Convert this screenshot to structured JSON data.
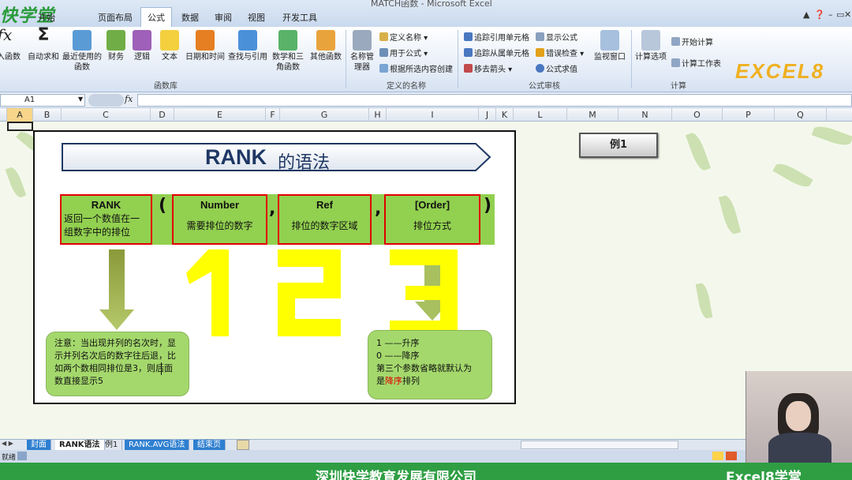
{
  "window": {
    "title": "MATCH函数 - Microsoft Excel"
  },
  "tabs": [
    "开始",
    "页面布局",
    "公式",
    "数据",
    "审阅",
    "视图",
    "开发工具"
  ],
  "active_tab": "公式",
  "ribbon": {
    "function_library": {
      "label": "函数库",
      "buttons": [
        {
          "label": "插入函数",
          "icon": "fx-icon"
        },
        {
          "label": "自动求和",
          "icon": "sigma-icon"
        },
        {
          "label": "最近使用的函数",
          "icon": "star-book-icon"
        },
        {
          "label": "财务",
          "icon": "book-icon"
        },
        {
          "label": "逻辑",
          "icon": "question-book-icon"
        },
        {
          "label": "文本",
          "icon": "a-book-icon"
        },
        {
          "label": "日期和时间",
          "icon": "calendar-book-icon"
        },
        {
          "label": "查找与引用",
          "icon": "lookup-book-icon"
        },
        {
          "label": "数学和三角函数",
          "icon": "theta-book-icon"
        },
        {
          "label": "其他函数",
          "icon": "more-books-icon"
        }
      ]
    },
    "defined_names": {
      "label": "定义的名称",
      "manager": "名称管理器",
      "items": [
        "定义名称",
        "用于公式",
        "根据所选内容创建"
      ]
    },
    "auditing": {
      "label": "公式审核",
      "items": [
        "追踪引用单元格",
        "追踪从属单元格",
        "移去箭头",
        "显示公式",
        "错误检查",
        "公式求值"
      ],
      "watch": "监视窗口"
    },
    "calculation": {
      "label": "计算",
      "options": "计算选项",
      "items": [
        "开始计算",
        "计算工作表"
      ]
    }
  },
  "brand_logo": "EXCEL8",
  "name_box": "A1",
  "fx_label": "fx",
  "columns": [
    "A",
    "B",
    "C",
    "D",
    "E",
    "F",
    "G",
    "H",
    "I",
    "J",
    "K",
    "L",
    "M",
    "N",
    "O",
    "P",
    "Q"
  ],
  "slide": {
    "title": "RANK",
    "title_suffix": "的语法",
    "boxes": [
      {
        "name": "RANK",
        "desc": "返回一个数值在一组数字中的排位"
      },
      {
        "name": "Number",
        "desc": "需要排位的数字"
      },
      {
        "name": "Ref",
        "desc": "排位的数字区域"
      },
      {
        "name": "[Order]",
        "desc": "排位方式"
      }
    ],
    "open_paren": "(",
    "close_paren": ")",
    "comma": ",",
    "numbers": [
      "1",
      "2",
      "3"
    ],
    "note_left": "注意：当出现并列的名次时，显示并列名次后的数字往后退，比如两个数相同排位是3，则后面数直接显示5",
    "note_right_lines": [
      "1 ——升序",
      "0 ——降序",
      "第三个参数省略就默认为"
    ],
    "note_right_prefix": "是",
    "note_right_highlight": "降序",
    "note_right_suffix": "排列"
  },
  "example_button": "例1",
  "sheet_tabs": [
    "封面",
    "RANK语法",
    "例1",
    "RANK.AVG语法",
    "结束页"
  ],
  "active_sheet": "RANK语法",
  "footer": {
    "company": "深圳快学教育发展有限公司",
    "brand": "Excel8学堂"
  },
  "colors": {
    "green_box": "#92d050",
    "red_border": "#e00000",
    "yellow": "#ffff00",
    "title_blue": "#1f3864",
    "footer_green": "#2f9e43"
  }
}
